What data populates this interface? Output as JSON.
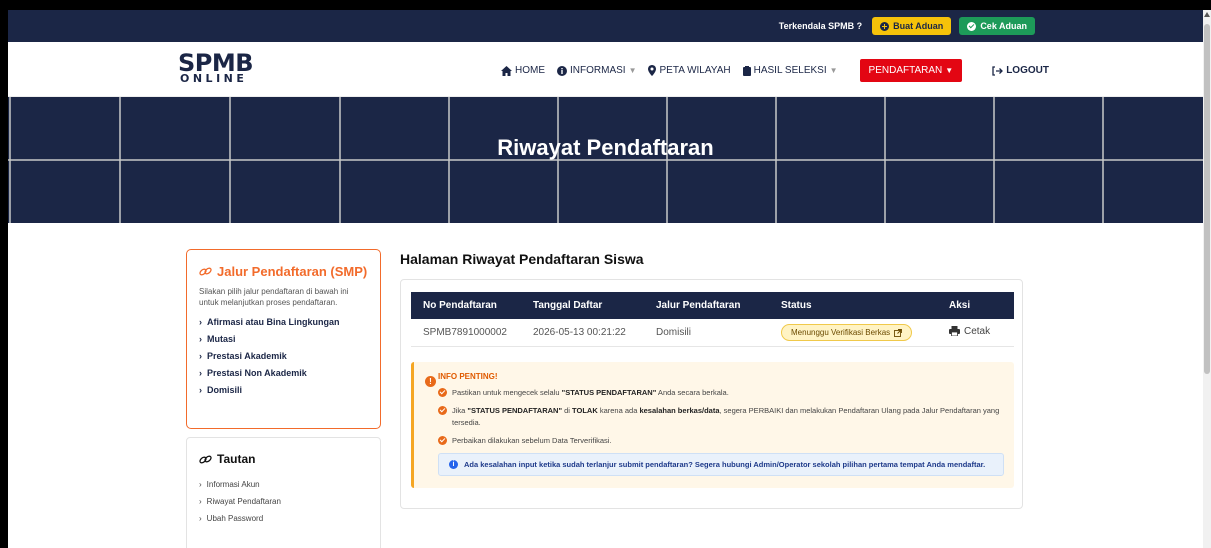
{
  "topbar": {
    "question": "Terkendala SPMB ?",
    "buat_aduan": "Buat Aduan",
    "cek_aduan": "Cek Aduan"
  },
  "logo": {
    "line1": "SPMB",
    "line2": "ONLINE"
  },
  "nav": {
    "home": "HOME",
    "informasi": "INFORMASI",
    "peta": "PETA WILAYAH",
    "hasil": "HASIL SELEKSI",
    "pendaftaran": "PENDAFTARAN",
    "logout": "LOGOUT"
  },
  "hero": {
    "title": "Riwayat Pendaftaran"
  },
  "sidebar": {
    "title": "Jalur Pendaftaran (SMP)",
    "desc": "Silakan pilih jalur pendaftaran di bawah ini untuk melanjutkan proses pendaftaran.",
    "items": [
      "Afirmasi atau Bina Lingkungan",
      "Mutasi",
      "Prestasi Akademik",
      "Prestasi Non Akademik",
      "Domisili"
    ]
  },
  "tautan": {
    "title": "Tautan",
    "items": [
      "Informasi Akun",
      "Riwayat Pendaftaran",
      "Ubah Password"
    ]
  },
  "main": {
    "title": "Halaman Riwayat Pendaftaran Siswa",
    "columns": [
      "No Pendaftaran",
      "Tanggal Daftar",
      "Jalur Pendaftaran",
      "Status",
      "Aksi"
    ],
    "row": {
      "no": "SPMB7891000002",
      "tanggal": "2026-05-13 00:21:22",
      "jalur": "Domisili",
      "status": "Menunggu Verifikasi Berkas",
      "aksi": "Cetak"
    }
  },
  "info": {
    "head": "INFO PENTING!",
    "item1_a": "Pastikan untuk mengecek selalu ",
    "item1_b": "\"STATUS PENDAFTARAN\"",
    "item1_c": " Anda secara berkala.",
    "item2_a": "Jika ",
    "item2_b": "\"STATUS PENDAFTARAN\"",
    "item2_c": " di ",
    "item2_d": "TOLAK",
    "item2_e": " karena ada ",
    "item2_f": "kesalahan berkas/data",
    "item2_g": ", segera PERBAIKI dan melakukan Pendaftaran Ulang pada Jalur Pendaftaran yang tersedia.",
    "item3": "Perbaikan dilakukan sebelum Data Terverifikasi.",
    "note": "Ada kesalahan input ketika sudah terlanjur submit pendaftaran? Segera hubungi Admin/Operator sekolah pilihan pertama tempat Anda mendaftar."
  },
  "colors": {
    "navy": "#1b2646",
    "accent_orange": "#f26b2b",
    "red": "#e30613",
    "yellow": "#f5c20a",
    "green": "#1d9a59"
  }
}
